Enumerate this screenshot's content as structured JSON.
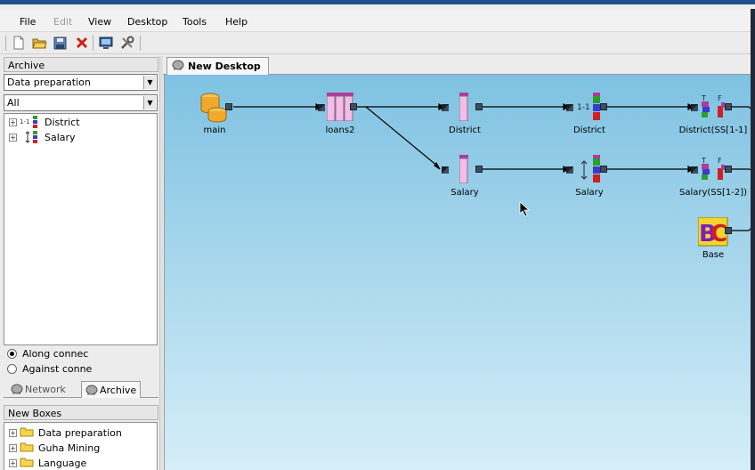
{
  "menu": {
    "items": [
      {
        "label": "File",
        "enabled": true
      },
      {
        "label": "Edit",
        "enabled": false
      },
      {
        "label": "View",
        "enabled": true
      },
      {
        "label": "Desktop",
        "enabled": true
      },
      {
        "label": "Tools",
        "enabled": true
      },
      {
        "label": "Help",
        "enabled": true
      }
    ]
  },
  "toolbar": {
    "icons": [
      "new-file-icon",
      "open-folder-icon",
      "save-icon",
      "delete-icon",
      "monitor-icon",
      "tools-icon"
    ]
  },
  "archive": {
    "title": "Archive",
    "category_select": "Data preparation",
    "filter_select": "All",
    "tree": [
      {
        "label": "District",
        "icon": "district-box-icon"
      },
      {
        "label": "Salary",
        "icon": "salary-box-icon"
      }
    ],
    "radio_options": [
      {
        "label": "Along connec",
        "checked": true
      },
      {
        "label": "Against conne",
        "checked": false
      }
    ],
    "tabs": [
      {
        "label": "Network",
        "active": false
      },
      {
        "label": "Archive",
        "active": true
      }
    ]
  },
  "new_boxes": {
    "title": "New Boxes",
    "items": [
      {
        "label": "Data preparation"
      },
      {
        "label": "Guha Mining"
      },
      {
        "label": "Language"
      }
    ]
  },
  "desktop": {
    "tab_label": "New Desktop",
    "nodes": [
      {
        "label": "main",
        "icon": "database-icon"
      },
      {
        "label": "loans2",
        "icon": "table-icon"
      },
      {
        "label": "District",
        "icon": "column-icon"
      },
      {
        "label": "Salary",
        "icon": "column-icon"
      },
      {
        "label": "District",
        "icon": "categorisation-icon"
      },
      {
        "label": "Salary",
        "icon": "equidistant-icon"
      },
      {
        "label": "District(SS[1-1]",
        "icon": "split-icon"
      },
      {
        "label": "Salary(SS[1-2])",
        "icon": "split-icon"
      },
      {
        "label": "Base",
        "icon": "base-icon"
      }
    ],
    "colors": {
      "canvas_top": "#7fc2e2",
      "canvas_bottom": "#d6eef8",
      "port": "#3c4d5e"
    }
  }
}
